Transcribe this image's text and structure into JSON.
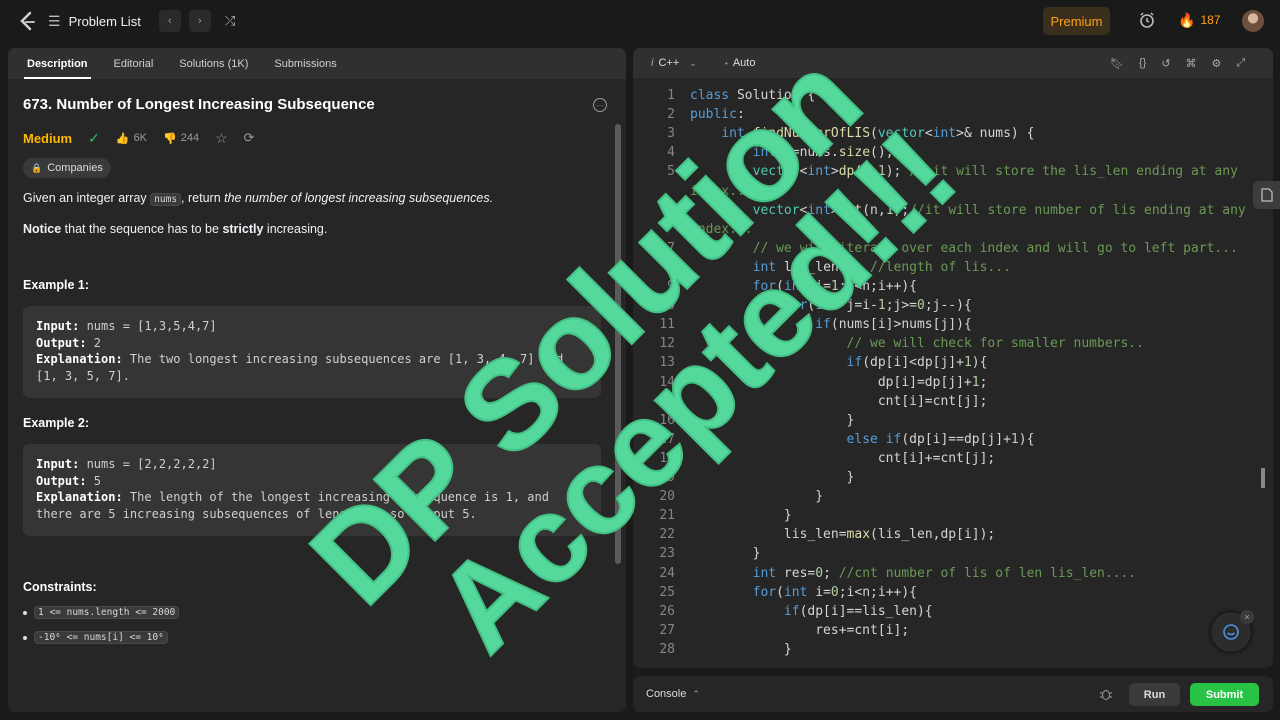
{
  "topbar": {
    "problem_list": "Problem List",
    "premium": "Premium",
    "streak": "187"
  },
  "left": {
    "tabs": [
      "Description",
      "Editorial",
      "Solutions (1K)",
      "Submissions"
    ],
    "title": "673. Number of Longest Increasing Subsequence",
    "difficulty": "Medium",
    "likes": "6K",
    "dislikes": "244",
    "companies": "Companies",
    "p1_pre": "Given an integer array ",
    "p1_code": "nums",
    "p1_mid": ", return ",
    "p1_em": "the number of longest increasing subsequences.",
    "p2_b1": "Notice",
    "p2_mid": " that the sequence has to be ",
    "p2_b2": "strictly",
    "p2_post": " increasing.",
    "ex1_title": "Example 1:",
    "ex1_input_label": "Input:",
    "ex1_input": " nums = [1,3,5,4,7]",
    "ex1_output_label": "Output:",
    "ex1_output": " 2",
    "ex1_expl_label": "Explanation:",
    "ex1_expl": " The two longest increasing subsequences are [1, 3, 4, 7] and [1, 3, 5, 7].",
    "ex2_title": "Example 2:",
    "ex2_input_label": "Input:",
    "ex2_input": " nums = [2,2,2,2,2]",
    "ex2_output_label": "Output:",
    "ex2_output": " 5",
    "ex2_expl_label": "Explanation:",
    "ex2_expl": " The length of the longest increasing subsequence is 1, and there are 5 increasing subsequences of length 1, so output 5.",
    "constraints_title": "Constraints:",
    "c1": "1 <= nums.length <= 2000",
    "c2": "-10⁶ <= nums[i] <= 10⁶"
  },
  "editor": {
    "language": "C++",
    "mode": "Auto",
    "lines": [
      {
        "n": "1",
        "html": "<span class='kw'>class</span> Solution {"
      },
      {
        "n": "2",
        "html": "<span class='kw'>public</span>:"
      },
      {
        "n": "3",
        "html": "    <span class='kw'>int</span> <span class='fn'>findNumberOfLIS</span>(<span class='ty'>vector</span>&lt;<span class='kw'>int</span>&gt;&amp; nums) {"
      },
      {
        "n": "4",
        "html": "        <span class='kw'>int</span> n=nums.<span class='fn'>size</span>();"
      },
      {
        "n": "5",
        "html": "        <span class='ty'>vector</span>&lt;<span class='kw'>int</span>&gt;<span class='fn'>dp</span>(n,<span class='nm'>1</span>); <span class='cm'>// it will store the lis_len ending at any</span>"
      },
      {
        "n": "",
        "html": "<span class='cm'>index....</span>"
      },
      {
        "n": "6",
        "html": "        <span class='ty'>vector</span>&lt;<span class='kw'>int</span>&gt;<span class='fn'>cnt</span>(n,<span class='nm'>1</span>);<span class='cm'>//it will store number of lis ending at any</span>"
      },
      {
        "n": "",
        "html": "<span class='cm'>index...</span>"
      },
      {
        "n": "7",
        "html": "        <span class='cm'>// we will iterate over each index and will go to left part...</span>"
      },
      {
        "n": "8",
        "html": "        <span class='kw'>int</span> lis_len=<span class='nm'>1</span>; <span class='cm'>//length of lis...</span>"
      },
      {
        "n": "9",
        "html": "        <span class='kw'>for</span>(<span class='kw'>int</span> i=<span class='nm'>1</span>;i&lt;n;i++){"
      },
      {
        "n": "10",
        "html": "            <span class='kw'>for</span>(<span class='kw'>int</span> j=i-<span class='nm'>1</span>;j&gt;=<span class='nm'>0</span>;j--){"
      },
      {
        "n": "11",
        "html": "                <span class='kw'>if</span>(nums[i]&gt;nums[j]){"
      },
      {
        "n": "12",
        "html": "                    <span class='cm'>// we will check for smaller numbers..</span>"
      },
      {
        "n": "13",
        "html": "                    <span class='kw'>if</span>(dp[i]&lt;dp[j]+<span class='nm'>1</span>){"
      },
      {
        "n": "14",
        "html": "                        dp[i]=dp[j]+<span class='nm'>1</span>;"
      },
      {
        "n": "15",
        "html": "                        cnt[i]=cnt[j];"
      },
      {
        "n": "16",
        "html": "                    }"
      },
      {
        "n": "17",
        "html": "                    <span class='kw'>else</span> <span class='kw'>if</span>(dp[i]==dp[j]+<span class='nm'>1</span>){"
      },
      {
        "n": "18",
        "html": "                        cnt[i]+=cnt[j];"
      },
      {
        "n": "19",
        "html": "                    }"
      },
      {
        "n": "20",
        "html": "                }"
      },
      {
        "n": "21",
        "html": "            }"
      },
      {
        "n": "22",
        "html": "            lis_len=<span class='fn'>max</span>(lis_len,dp[i]);"
      },
      {
        "n": "23",
        "html": "        }"
      },
      {
        "n": "24",
        "html": "        <span class='kw'>int</span> res=<span class='nm'>0</span>; <span class='cm'>//cnt number of lis of len lis_len....</span>"
      },
      {
        "n": "25",
        "html": "        <span class='kw'>for</span>(<span class='kw'>int</span> i=<span class='nm'>0</span>;i&lt;n;i++){"
      },
      {
        "n": "26",
        "html": "            <span class='kw'>if</span>(dp[i]==lis_len){"
      },
      {
        "n": "27",
        "html": "                res+=cnt[i];"
      },
      {
        "n": "28",
        "html": "            }"
      }
    ]
  },
  "console": {
    "label": "Console",
    "run": "Run",
    "submit": "Submit"
  },
  "overlay": {
    "line1": "DP Solution",
    "line2": "Accepted!!!"
  },
  "colors": {
    "overlay": "#55d89c",
    "accent": "#ffa116",
    "submit": "#28c244",
    "medium": "#ffb800"
  }
}
